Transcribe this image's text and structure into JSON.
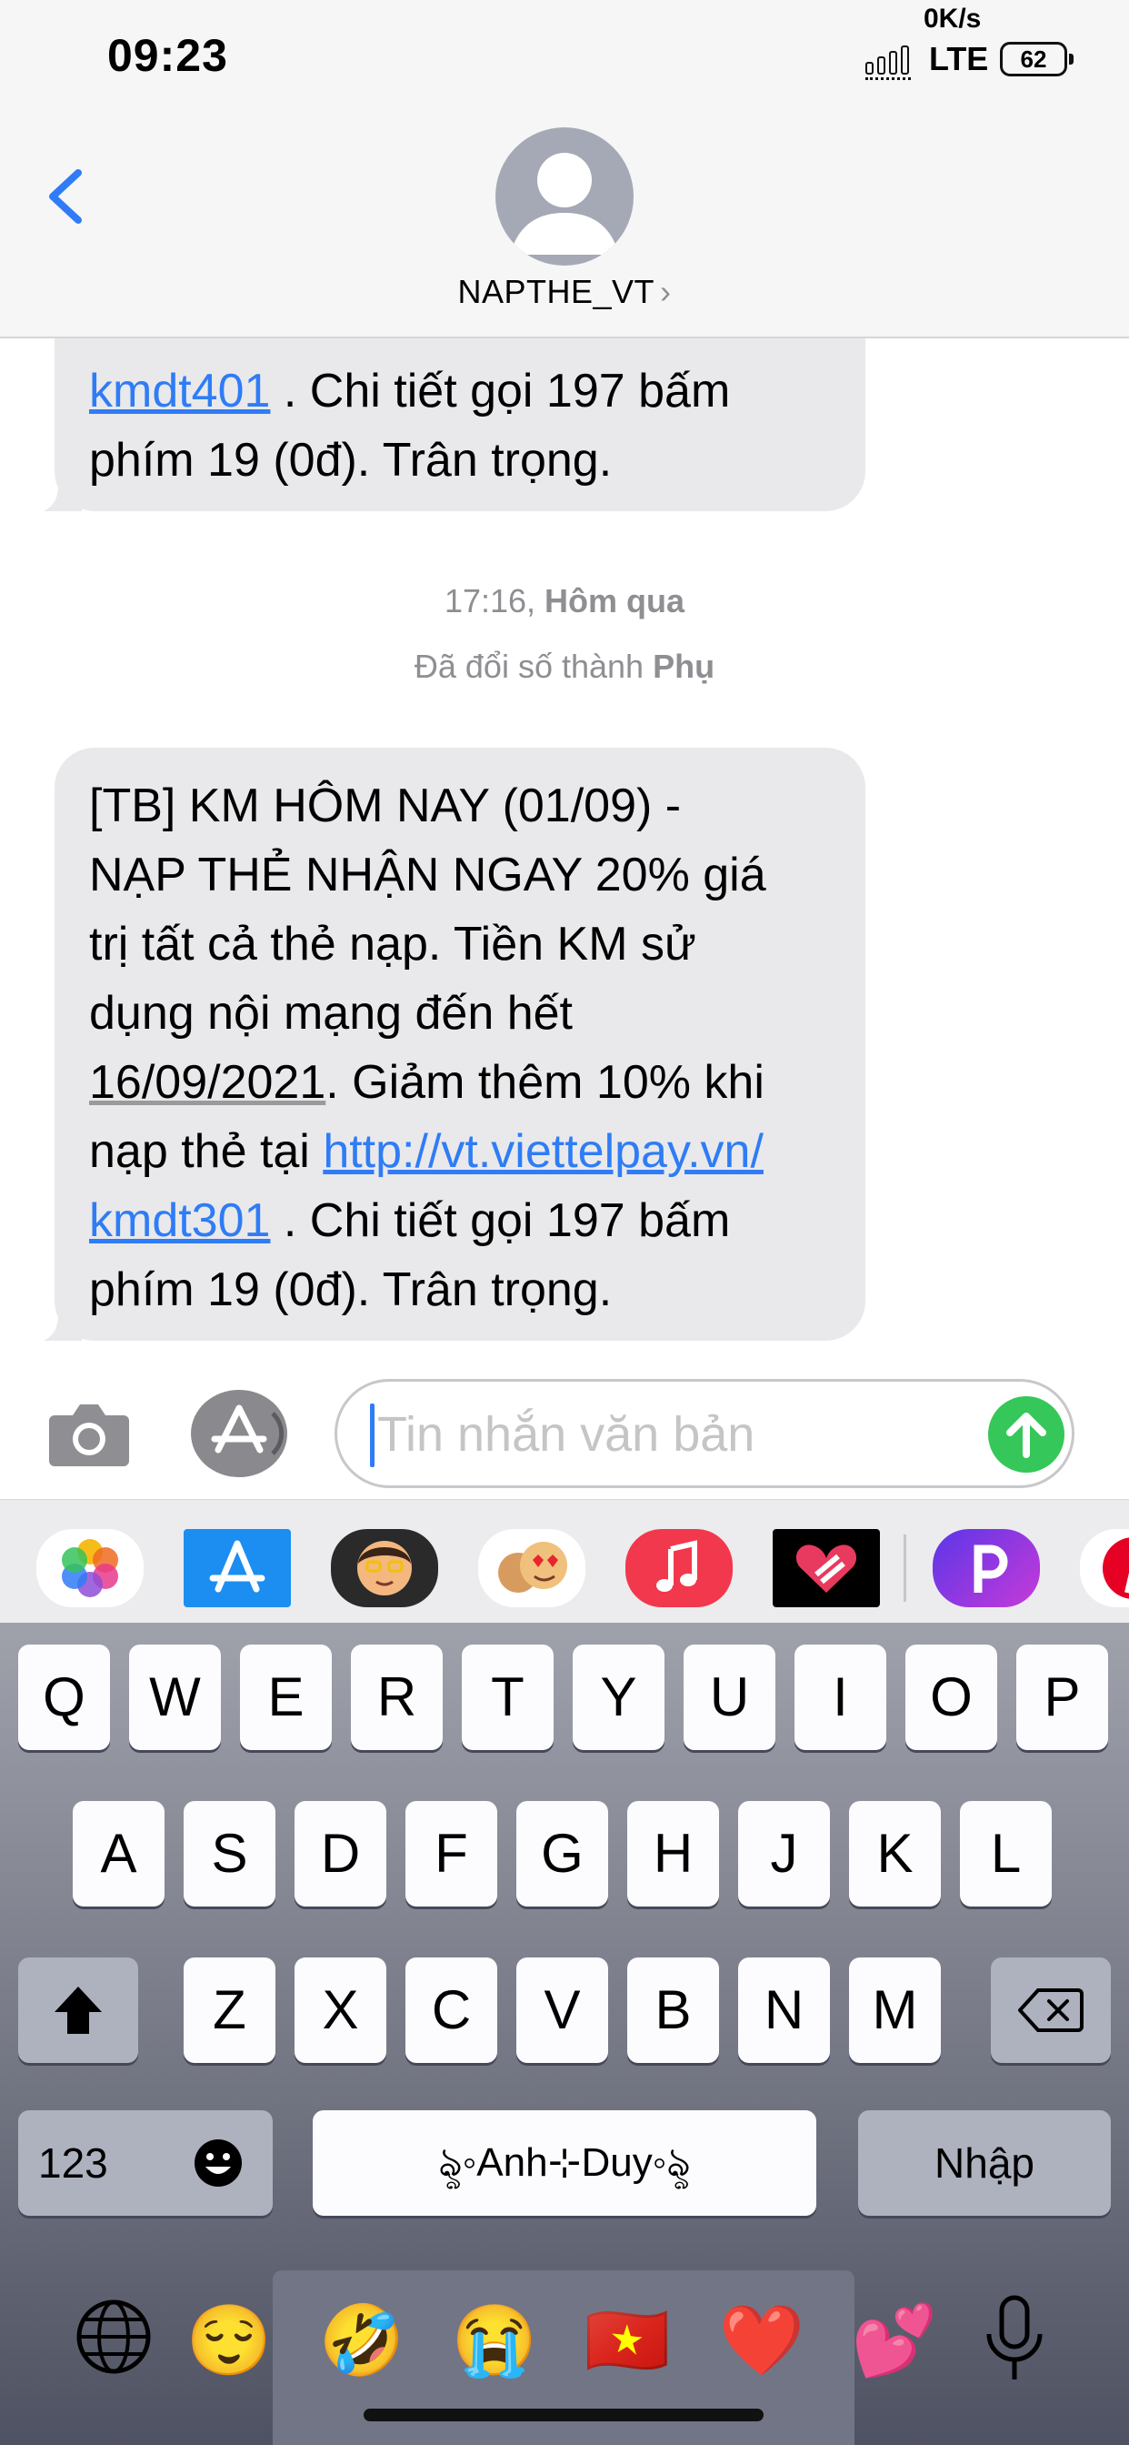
{
  "status_bar": {
    "time": "09:23",
    "net_speed": "0K/s",
    "network": "LTE",
    "battery": "62"
  },
  "header": {
    "contact_name": "NAPTHE_VT",
    "chevron": "›"
  },
  "messages": [
    {
      "partial_visible": true,
      "link": "kmdt401",
      "line1_rest": " . Chi tiết gọi 197 bấm",
      "line2": "phím 19 (0đ). Trân trọng."
    },
    {
      "line1": "[TB] KM HÔM NAY (01/09) -",
      "line2": "NẠP THẺ NHẬN NGAY 20% giá",
      "line3": "trị tất cả thẻ nạp. Tiền KM sử",
      "line4": "dụng nội mạng đến hết",
      "date": "16/09/2021",
      "line5_rest": ". Giảm thêm 10% khi",
      "line6_text": "nạp thẻ tại ",
      "link_part1": "http://vt.viettelpay.vn/",
      "link_part2": "kmdt301",
      "line7_rest": " . Chi tiết gọi 197 bấm",
      "line8": "phím 19 (0đ). Trân trọng."
    }
  ],
  "timestamp": {
    "time": "17:16,",
    "day": "Hôm qua"
  },
  "sender_note": {
    "text": "Đã đổi số thành",
    "bold": "Phụ"
  },
  "input": {
    "placeholder": "Tin nhắn văn bản"
  },
  "app_strip": [
    {
      "name": "photos-app-icon"
    },
    {
      "name": "app-store-app-icon"
    },
    {
      "name": "memoji-app-icon"
    },
    {
      "name": "memoji-stickers-app-icon"
    },
    {
      "name": "music-app-icon"
    },
    {
      "name": "heart-sticker-app-icon"
    },
    {
      "name": "picsart-app-icon"
    },
    {
      "name": "pinterest-app-icon"
    }
  ],
  "keyboard": {
    "row1": [
      "Q",
      "W",
      "E",
      "R",
      "T",
      "Y",
      "U",
      "I",
      "O",
      "P"
    ],
    "row2": [
      "A",
      "S",
      "D",
      "F",
      "G",
      "H",
      "J",
      "K",
      "L"
    ],
    "row3": [
      "Z",
      "X",
      "C",
      "V",
      "B",
      "N",
      "M"
    ],
    "numbers_label": "123",
    "space_label": "ৡ◦Anh⊹Duy◦ৡ",
    "return_label": "Nhập",
    "emoji_row": [
      "😌",
      "🤣",
      "😭",
      "🇻🇳",
      "❤️",
      "💕"
    ]
  },
  "colors": {
    "bubble": "#e9e9eb",
    "link": "#2f7cf6",
    "send": "#35c759",
    "header_bg": "#f6f6f6"
  }
}
